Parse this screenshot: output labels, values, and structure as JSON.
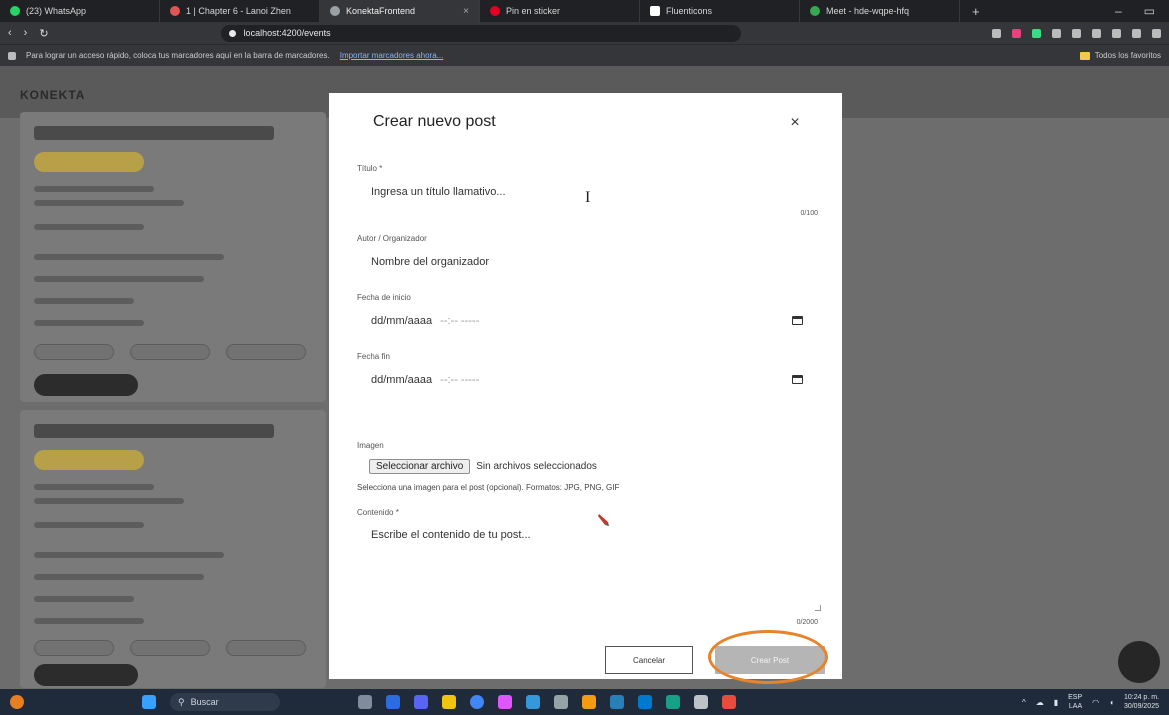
{
  "browser": {
    "tabs": [
      {
        "label": "(23) WhatsApp",
        "color": "#25d366",
        "active": false
      },
      {
        "label": "1 | Chapter 6 - Lanoi Zhen",
        "color": "#e05555",
        "active": false
      },
      {
        "label": "KonektaFrontend",
        "color": "#9aa0a6",
        "active": true
      },
      {
        "label": "Pin en sticker",
        "color": "#e60023",
        "active": false
      },
      {
        "label": "Fluenticons",
        "color": "#ffffff",
        "active": false
      },
      {
        "label": "Meet - hde-wqpe-hfq",
        "color": "#34a853",
        "active": false
      }
    ],
    "url": "localhost:4200/events",
    "bookmarks_prompt": "Para lograr un acceso rápido, coloca tus marcadores aquí en la barra de marcadores.",
    "bookmarks_link": "Importar marcadores ahora...",
    "all_bookmarks": "Todos los favoritos"
  },
  "page": {
    "brand": "KONEKTA"
  },
  "modal": {
    "title": "Crear nuevo post",
    "close_glyph": "×",
    "title_label": "Título *",
    "title_placeholder": "Ingresa un título llamativo...",
    "title_counter": "0/100",
    "author_label": "Autor / Organizador",
    "author_placeholder": "Nombre del organizador",
    "start_label": "Fecha de inicio",
    "start_placeholder": "dd/mm/aaaa",
    "start_time": "--:-- -----",
    "end_label": "Fecha fin",
    "end_placeholder": "dd/mm/aaaa",
    "end_time": "--:-- -----",
    "image_label": "Imagen",
    "file_button": "Seleccionar archivo",
    "file_status": "Sin archivos seleccionados",
    "image_hint": "Selecciona una imagen para el post (opcional). Formatos: JPG, PNG, GIF",
    "content_label": "Contenido *",
    "content_placeholder": "Escribe el contenido de tu post...",
    "content_counter": "0/2000",
    "cancel_label": "Cancelar",
    "create_label": "Crear Post",
    "text_cursor_glyph": "I"
  },
  "taskbar": {
    "search_label": "Buscar",
    "lang_top": "ESP",
    "lang_bottom": "LAA",
    "time": "10:24 p. m.",
    "date": "30/09/2025"
  },
  "colors": {
    "highlight": "#e8832a",
    "overlay": "#6d6d6d"
  }
}
